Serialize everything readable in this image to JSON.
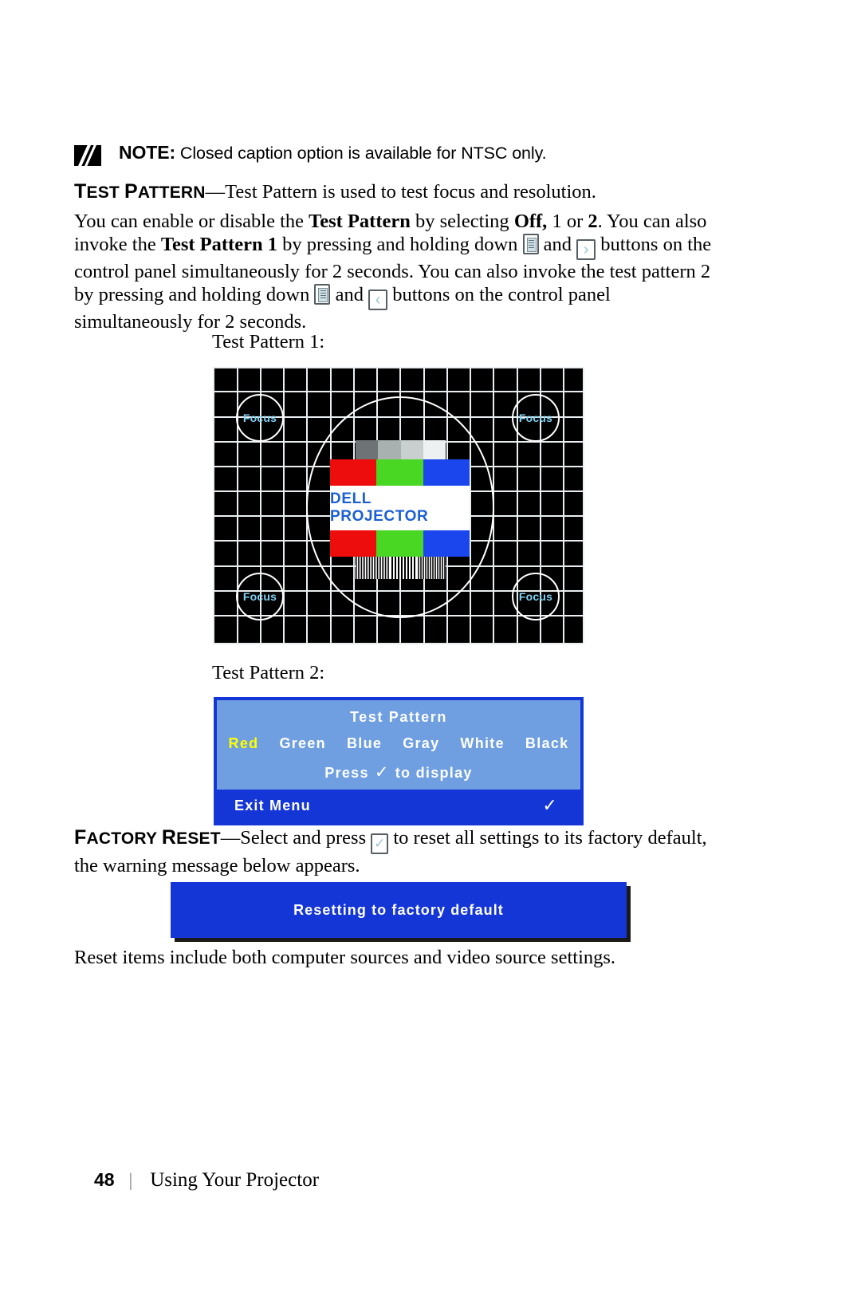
{
  "note": {
    "icon": "note-pencil-icon",
    "label": "NOTE:",
    "text": " Closed caption option is available for NTSC only."
  },
  "test_pattern_section": {
    "term": "TEST PATTERN",
    "term_first": "T",
    "term_rest": "EST ",
    "term_second_first": "P",
    "term_second_rest": "ATTERN",
    "dash_def": "—Test Pattern is used to test focus and resolution.",
    "para_part1": "You can enable or disable the ",
    "para_bold1": "Test Pattern",
    "para_part2": " by selecting ",
    "para_bold2": "Off,",
    "para_part3": " 1 or ",
    "para_bold3": "2",
    "para_part4": ". You can also invoke the ",
    "para_bold4": "Test Pattern 1",
    "para_part5": " by pressing and holding down ",
    "para_part6": " and ",
    "para_part7": " buttons on the control panel simultaneously for 2 seconds. You can also invoke the test pattern 2 by pressing and holding down ",
    "para_part8": " and ",
    "para_part9": " buttons on the control panel simultaneously for 2 seconds."
  },
  "captions": {
    "pattern1": "Test Pattern 1:",
    "pattern2": "Test Pattern 2:"
  },
  "pattern_image": {
    "focus_labels": [
      "Focus",
      "Focus",
      "Focus",
      "Focus"
    ],
    "brand_text": "DELL PROJECTOR",
    "gray_steps": [
      "#6e7475",
      "#a9b0b0",
      "#c9cfcf",
      "#eef1f1"
    ],
    "color_bars": [
      "#ee0d0d",
      "#4ad723",
      "#1b46ee"
    ],
    "background": "#000000",
    "grid_color": "#e9eef0",
    "brand_color": "#1a5fd4",
    "focus_text_color": "#7fd2f5"
  },
  "osd": {
    "title": "Test Pattern",
    "options": [
      "Red",
      "Green",
      "Blue",
      "Gray",
      "White",
      "Black"
    ],
    "selected_option": "Red",
    "selected_color": "#ffff00",
    "press_before": "Press",
    "press_check": "✓",
    "press_after": "to display",
    "exit_label": "Exit Menu",
    "exit_check": "✓",
    "body_color": "#6f9fe0",
    "border_color": "#1536d6"
  },
  "factory_reset_section": {
    "term_first": "F",
    "term_rest": "ACTORY ",
    "term_second_first": "R",
    "term_second_rest": "ESET",
    "part1": "—Select and press ",
    "part2": " to reset all settings to its factory default, the warning message below appears."
  },
  "reset_message": {
    "text": "Resetting to factory default",
    "bg_color": "#1536d6"
  },
  "reset_items_text": "Reset items include both computer sources and video source settings.",
  "footer": {
    "page_number": "48",
    "separator": "|",
    "title": "Using Your Projector"
  },
  "icons": {
    "menu_key": "menu-key-icon",
    "right_key": "right-arrow-key-icon",
    "left_key": "left-arrow-key-icon",
    "check_key": "check-key-icon",
    "right_glyph": "›",
    "left_glyph": "‹",
    "check_glyph": "✓"
  }
}
